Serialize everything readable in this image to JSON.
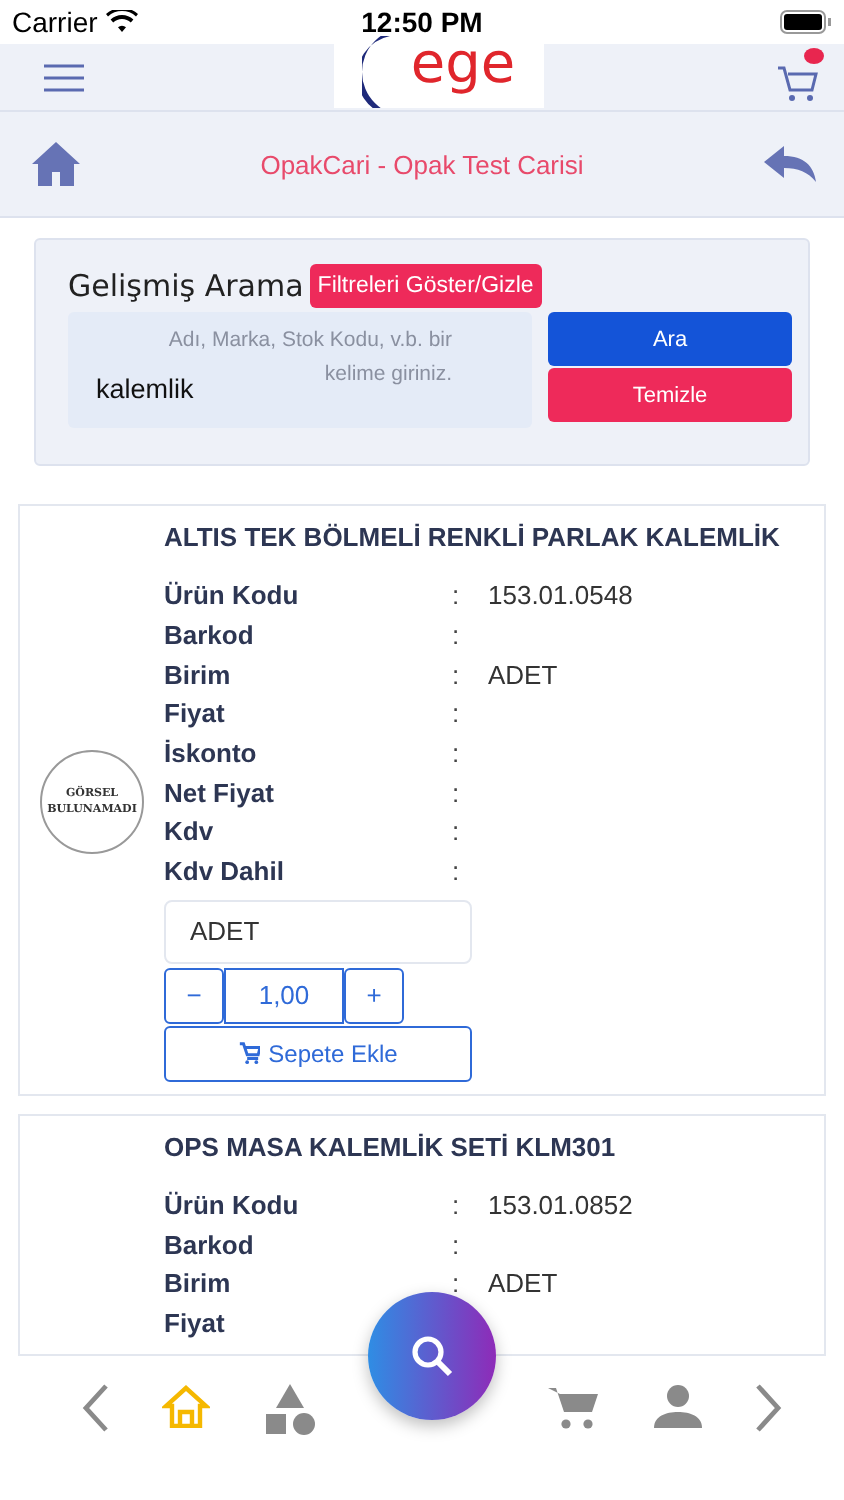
{
  "status_bar": {
    "carrier": "Carrier",
    "time": "12:50 PM"
  },
  "header": {
    "logo_text": "ege",
    "cart_badge": true
  },
  "subheader": {
    "title": "OpakCari - Opak Test Carisi"
  },
  "search": {
    "title": "Gelişmiş Arama",
    "filter_button": "Filtreleri Göster/Gizle",
    "placeholder": "Adı, Marka, Stok Kodu, v.b. bir kelime giriniz.",
    "value": "kalemlik",
    "search_button": "Ara",
    "clear_button": "Temizle"
  },
  "products": [
    {
      "name": "ALTIS TEK BÖLMELİ RENKLİ PARLAK KALEMLİK",
      "image_text": [
        "GÖRSEL",
        "BULUNAMADI"
      ],
      "fields": [
        {
          "label": "Ürün Kodu",
          "sep": ":",
          "value": "153.01.0548"
        },
        {
          "label": "Barkod",
          "sep": ":"
        },
        {
          "label": "Birim",
          "sep": ":",
          "value": "ADET"
        },
        {
          "label": "Fiyat",
          "sep": ":"
        },
        {
          "label": "İskonto",
          "sep": ":"
        },
        {
          "label": "Net Fiyat",
          "sep": ":"
        },
        {
          "label": "Kdv",
          "sep": ":"
        },
        {
          "label": "Kdv Dahil",
          "sep": ":"
        }
      ],
      "unit": "ADET",
      "minus": "−",
      "quantity": "1,00",
      "plus": "+",
      "add_button": "Sepete Ekle"
    },
    {
      "name": "OPS MASA KALEMLİK SETİ KLM301",
      "fields": [
        {
          "label": "Ürün Kodu",
          "sep": ":",
          "value": "153.01.0852"
        },
        {
          "label": "Barkod",
          "sep": ":"
        },
        {
          "label": "Birim",
          "sep": ":",
          "value": "ADET"
        },
        {
          "label": "Fiyat"
        }
      ]
    }
  ],
  "bottom_nav": {
    "items": [
      {
        "kind": "prev",
        "selected": false
      },
      {
        "kind": "home",
        "selected": true
      },
      {
        "kind": "categories",
        "selected": false
      },
      {
        "kind": "search",
        "selected": false
      },
      {
        "kind": "cart",
        "selected": false
      },
      {
        "kind": "account",
        "selected": false
      },
      {
        "kind": "next",
        "selected": false
      }
    ]
  }
}
